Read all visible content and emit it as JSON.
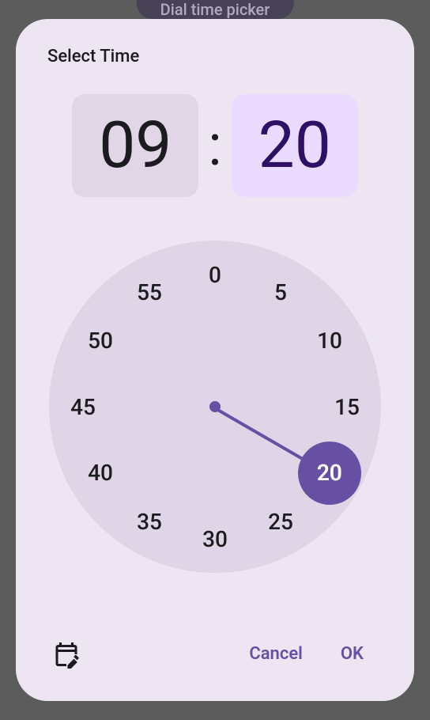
{
  "background": {
    "button_label": "Dial time picker"
  },
  "dialog": {
    "title": "Select Time",
    "hours": "09",
    "minutes": "20",
    "colon": ":",
    "active_field": "minutes",
    "clock": {
      "labels": [
        "0",
        "5",
        "10",
        "15",
        "20",
        "25",
        "30",
        "35",
        "40",
        "45",
        "50",
        "55"
      ],
      "selected_value": "20",
      "selected_index": 4
    },
    "buttons": {
      "cancel": "Cancel",
      "ok": "OK"
    }
  }
}
